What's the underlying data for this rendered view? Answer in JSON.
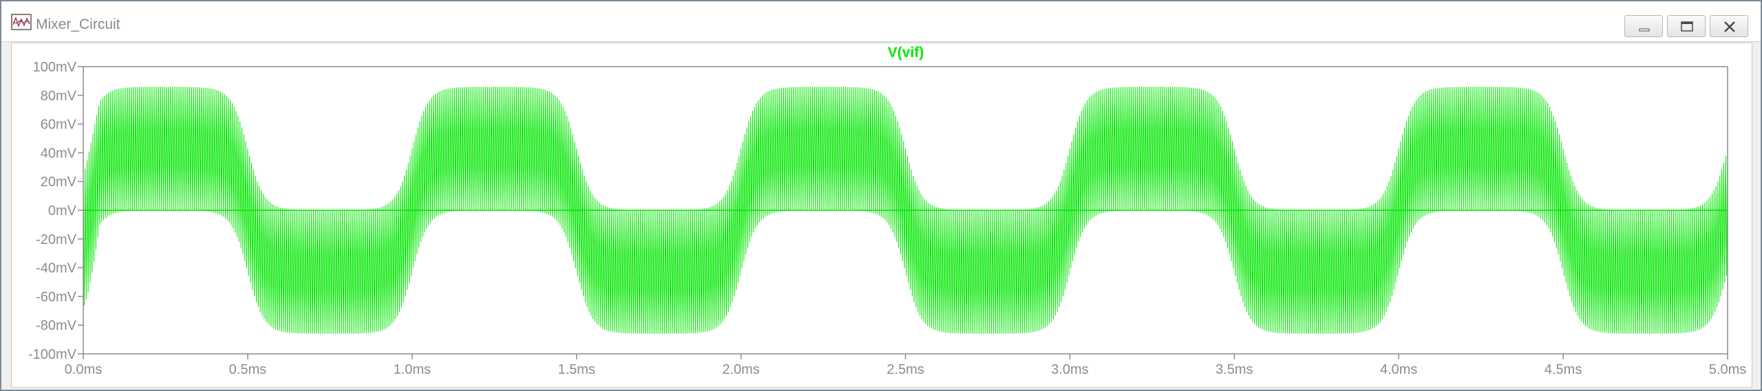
{
  "window": {
    "title": "Mixer_Circuit",
    "icon": "waveform-viewer-icon",
    "controls": {
      "minimize_icon": "minimize-icon",
      "maximize_icon": "maximize-icon",
      "close_icon": "close-icon"
    }
  },
  "colors": {
    "trace": "#00e600",
    "axis": "#8c8c8c",
    "title": "#00e600"
  },
  "chart_data": {
    "type": "line",
    "title": "V(vif)",
    "xlabel": "",
    "ylabel": "",
    "x_unit": "ms",
    "y_unit": "mV",
    "xlim": [
      0.0,
      5.0
    ],
    "ylim": [
      -100,
      100
    ],
    "xticks": [
      "0.0ms",
      "0.5ms",
      "1.0ms",
      "1.5ms",
      "2.0ms",
      "2.5ms",
      "3.0ms",
      "3.5ms",
      "4.0ms",
      "4.5ms",
      "5.0ms"
    ],
    "yticks": [
      "100mV",
      "80mV",
      "60mV",
      "40mV",
      "20mV",
      "0mV",
      "-20mV",
      "-40mV",
      "-60mV",
      "-80mV",
      "-100mV"
    ],
    "grid": false,
    "series": [
      {
        "name": "V(vif)",
        "envelope_period_ms": 1.0,
        "peak_mV": 86,
        "description_points": {
          "x": [
            0.0,
            0.25,
            0.5,
            0.75,
            1.0,
            1.25,
            1.5,
            1.75,
            2.0,
            2.25,
            2.5,
            2.75,
            3.0,
            3.25,
            3.5,
            3.75,
            4.0,
            4.25,
            4.5,
            4.75,
            5.0
          ],
          "upper": [
            40,
            86,
            40,
            0,
            40,
            86,
            40,
            0,
            40,
            86,
            40,
            0,
            40,
            86,
            40,
            0,
            40,
            86,
            40,
            0,
            55
          ],
          "lower": [
            -40,
            0,
            -40,
            -86,
            -40,
            0,
            -40,
            -86,
            -40,
            0,
            -40,
            -86,
            -40,
            0,
            -40,
            -86,
            -40,
            0,
            -40,
            -86,
            -80
          ]
        }
      }
    ]
  }
}
